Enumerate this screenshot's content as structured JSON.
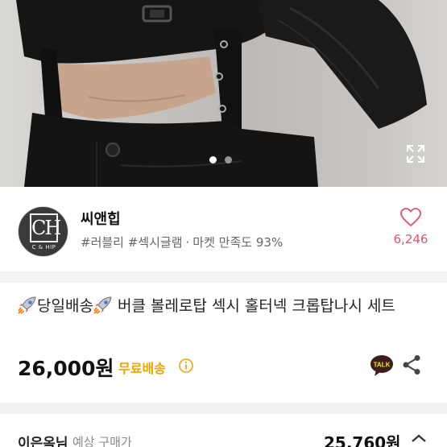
{
  "product_photo": {
    "slide_count": 2,
    "active_slide": 1
  },
  "seller": {
    "name": "씨앤힙",
    "avatar_monogram": "CH",
    "avatar_caption": "C & HIP",
    "tags": "#러블리 #섹시글램",
    "satisfaction_label": "마켓 만족도",
    "satisfaction_value": "93%",
    "like_count": "6,246"
  },
  "listing": {
    "title": "당일배송 버클 볼레로탑 섹시 홀터넥 크롭탑나시 세트",
    "title_pre": "당일배송",
    "title_post": " 버클 볼레로탑 섹시 홀터넥 크롭탑나시 세트",
    "price": "26,000원",
    "shipping": "무료배송",
    "talk_label": "TALK"
  },
  "expected_purchase": {
    "buyer": "이은옥님",
    "label": "예상 구매가",
    "price": "25,760원"
  },
  "colors": {
    "accent_like": "#e8506b",
    "shipping_badge": "#f0a400",
    "talk_yellow": "#3c1e1e"
  },
  "icons": [
    "expand-icon",
    "heart-icon",
    "rocket-icon",
    "info-icon",
    "kakao-talk-icon",
    "share-icon",
    "chevron-down-icon"
  ]
}
